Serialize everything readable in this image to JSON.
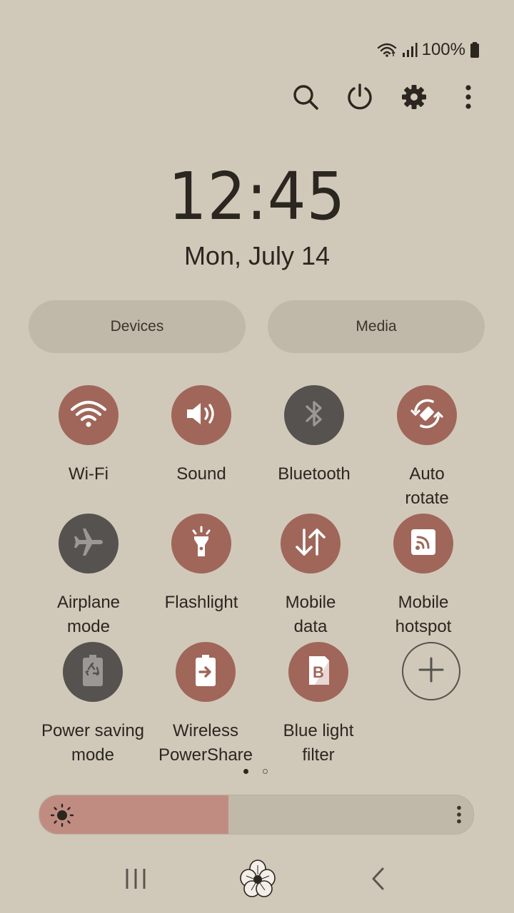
{
  "status": {
    "battery_text": "100%",
    "icons": [
      "wifi-icon",
      "signal-icon",
      "battery-icon"
    ]
  },
  "top_actions": [
    "search-icon",
    "power-icon",
    "settings-gear-icon",
    "more-vertical-icon"
  ],
  "clock": {
    "time": "12:45",
    "date": "Mon, July 14"
  },
  "pills": {
    "devices": "Devices",
    "media": "Media"
  },
  "tiles": [
    {
      "label": "Wi-Fi",
      "state": "on",
      "icon": "wifi-icon"
    },
    {
      "label": "Sound",
      "state": "on",
      "icon": "sound-icon"
    },
    {
      "label": "Bluetooth",
      "state": "off",
      "icon": "bluetooth-icon"
    },
    {
      "label": "Auto\nrotate",
      "state": "on",
      "icon": "auto-rotate-icon"
    },
    {
      "label": "Airplane\nmode",
      "state": "off",
      "icon": "airplane-icon"
    },
    {
      "label": "Flashlight",
      "state": "on",
      "icon": "flashlight-icon"
    },
    {
      "label": "Mobile\ndata",
      "state": "on",
      "icon": "mobile-data-icon"
    },
    {
      "label": "Mobile\nhotspot",
      "state": "on",
      "icon": "hotspot-icon"
    },
    {
      "label": "Power saving\nmode",
      "state": "off",
      "icon": "power-saving-icon"
    },
    {
      "label": "Wireless\nPowerShare",
      "state": "on",
      "icon": "wireless-powershare-icon"
    },
    {
      "label": "Blue light\nfilter",
      "state": "on",
      "icon": "blue-light-filter-icon"
    },
    {
      "label": "",
      "state": "add",
      "icon": "add-icon"
    }
  ],
  "pages": {
    "current": 1,
    "total": 2
  },
  "brightness": {
    "level": 0.436,
    "icon": "brightness-sun-icon"
  },
  "colors": {
    "background": "#d0c9b9",
    "tile_on": "#a0665a",
    "tile_off": "#55524f",
    "brightness_fill": "#c08c82"
  },
  "nav": [
    "recent-apps-icon",
    "home-flower-icon",
    "back-icon"
  ]
}
